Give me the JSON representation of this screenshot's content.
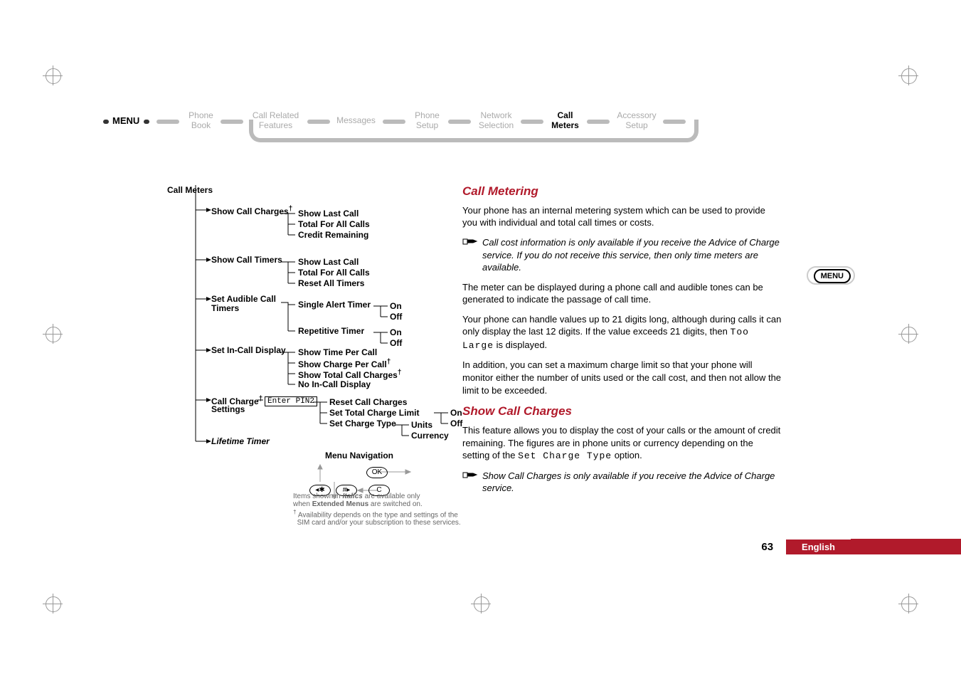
{
  "menu": {
    "rootLabel": "MENU",
    "items": [
      {
        "label": "Phone\nBook"
      },
      {
        "label": "Call Related\nFeatures"
      },
      {
        "label": "Messages"
      },
      {
        "label": "Phone\nSetup"
      },
      {
        "label": "Network\nSelection"
      },
      {
        "label": "Call\nMeters",
        "current": true
      },
      {
        "label": "Accessory\nSetup"
      }
    ]
  },
  "tree": {
    "title": "Call Meters",
    "nodes": {
      "showCallCharges": "Show Call Charges",
      "showLastCall1": "Show Last Call",
      "totalAllCalls1": "Total For All Calls",
      "creditRemaining": "Credit Remaining",
      "showCallTimers": "Show Call Timers",
      "showLastCall2": "Show Last Call",
      "totalAllCalls2": "Total For All Calls",
      "resetAllTimers": "Reset All Timers",
      "setAudibleCall": "Set Audible Call",
      "timers": "Timers",
      "singleAlertTimer": "Single Alert Timer",
      "repetitiveTimer": "Repetitive Timer",
      "on1": "On",
      "off1": "Off",
      "on2": "On",
      "off2": "Off",
      "setInCallDisplay": "Set In-Call Display",
      "showTimePerCall": "Show Time Per Call",
      "showChargePerCall": "Show Charge Per Call",
      "showTotalCallCharges": "Show Total Call Charges",
      "noInCallDisplay": "No In-Call Display",
      "callCharge": "Call Charge",
      "settings": "Settings",
      "enterPin2": "Enter PIN2",
      "resetCallCharges": "Reset Call Charges",
      "setTotalChargeLimit": "Set Total Charge Limit",
      "setChargeType": "Set Charge Type",
      "units": "Units",
      "currency": "Currency",
      "on3": "On",
      "off3": "Off",
      "lifetimeTimer": "Lifetime Timer"
    },
    "menuNavTitle": "Menu Navigation",
    "keys": {
      "starLeft": "◂✱",
      "hashRight": "#▸",
      "ok": "OK",
      "c": "C"
    },
    "footnote1a": "Items shown in ",
    "footnote1b": "Italics",
    "footnote1c": " are available only",
    "footnote2a": "when ",
    "footnote2b": "Extended Menus",
    "footnote2c": " are switched on.",
    "footnote3": "Availability depends on the type and settings of the",
    "footnote4": "SIM card and/or your subscription to these services."
  },
  "dagger": "†",
  "content": {
    "h1": "Call Metering",
    "p1": "Your phone has an internal metering system which can be used to provide you with individual and total call times or costs.",
    "note1": "Call cost information is only available if you receive the Advice of Charge service. If you do not receive this service, then only time meters are available.",
    "p2": "The meter can be displayed during a phone call and audible tones can be generated to indicate the passage of call time.",
    "p3a": "Your phone can handle values up to 21 digits long, although during calls it can only display the last 12 digits. If the value exceeds 21 digits, then ",
    "p3mono": "Too Large",
    "p3b": " is displayed.",
    "p4": "In addition, you can set a maximum charge limit so that your phone will monitor either the number of units used or the call cost, and then not allow the limit to be exceeded.",
    "h2": "Show Call Charges",
    "p5a": "This feature allows you to display the cost of your calls or the amount of credit remaining. The figures are in phone units or currency depending on the setting of the ",
    "p5mono": "Set Charge Type",
    "p5b": " option.",
    "note2": "Show Call Charges is only available if you receive the Advice of Charge service."
  },
  "sideBadge": "MENU",
  "footer": {
    "page": "63",
    "lang": "English"
  }
}
